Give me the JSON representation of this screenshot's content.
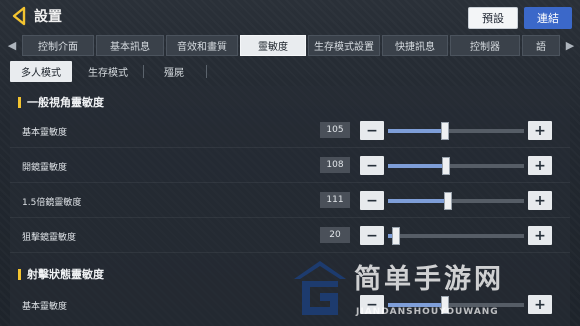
{
  "header": {
    "title": "設置",
    "preset_label": "預設",
    "link_label": "連結"
  },
  "tabs": [
    {
      "label": "控制介面",
      "active": false
    },
    {
      "label": "基本訊息",
      "active": false
    },
    {
      "label": "音效和畫質",
      "active": false
    },
    {
      "label": "靈敏度",
      "active": true
    },
    {
      "label": "生存模式設置",
      "active": false
    },
    {
      "label": "快捷訊息",
      "active": false
    },
    {
      "label": "控制器",
      "active": false
    },
    {
      "label": "語",
      "active": false
    }
  ],
  "subtabs": [
    {
      "label": "多人模式",
      "active": true
    },
    {
      "label": "生存模式",
      "active": false
    },
    {
      "label": "殭屍",
      "active": false
    }
  ],
  "sections": [
    {
      "title": "一般視角靈敏度",
      "rows": [
        {
          "label": "基本靈敏度",
          "value": "105",
          "fraction": 0.42
        },
        {
          "label": "開鏡靈敏度",
          "value": "108",
          "fraction": 0.43
        },
        {
          "label": "1.5倍鏡靈敏度",
          "value": "111",
          "fraction": 0.44
        },
        {
          "label": "狙擊鏡靈敏度",
          "value": "20",
          "fraction": 0.06
        }
      ]
    },
    {
      "title": "射擊狀態靈敏度",
      "rows": [
        {
          "label": "基本靈敏度",
          "value": "",
          "fraction": 0.42
        }
      ]
    }
  ],
  "watermark": {
    "text": "简单手游网",
    "subtext": "JIANDANSHOUYOUWANG"
  },
  "colors": {
    "accent_yellow": "#f4c430",
    "slider_fill": "#7e9ed8",
    "link_button": "#3b68c9"
  }
}
